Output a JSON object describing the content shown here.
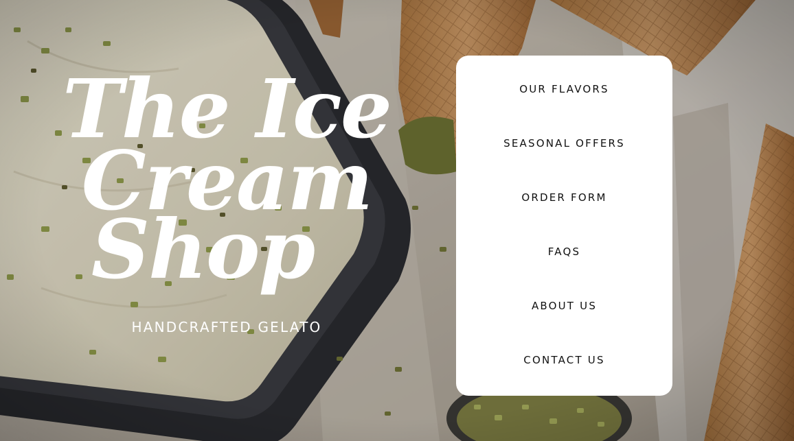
{
  "brand": {
    "logo_text": "The Ice Cream Shop",
    "tagline": "HANDCRAFTED GELATO"
  },
  "nav": {
    "items": [
      {
        "label": "OUR FLAVORS"
      },
      {
        "label": "SEASONAL OFFERS"
      },
      {
        "label": "ORDER FORM"
      },
      {
        "label": "FAQS"
      },
      {
        "label": "ABOUT US"
      },
      {
        "label": "CONTACT US"
      }
    ]
  },
  "colors": {
    "card": "#ffffff",
    "nav_text": "#111111",
    "logo_text": "#ffffff"
  }
}
